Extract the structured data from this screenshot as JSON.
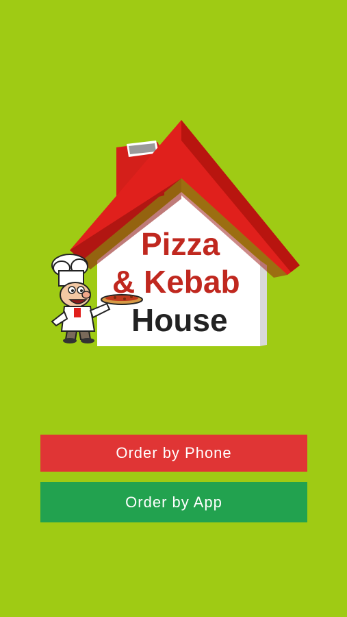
{
  "logo": {
    "line1": "Pizza",
    "line2": "& Kebab",
    "line3": "House"
  },
  "buttons": {
    "phone_label": "Order by Phone",
    "app_label": "Order by App"
  },
  "colors": {
    "background": "#9fcb14",
    "phone_button": "#e03535",
    "app_button": "#22a24f",
    "roof": "#e0201c",
    "logo_text_red": "#c0281f",
    "logo_text_dark": "#222222"
  }
}
